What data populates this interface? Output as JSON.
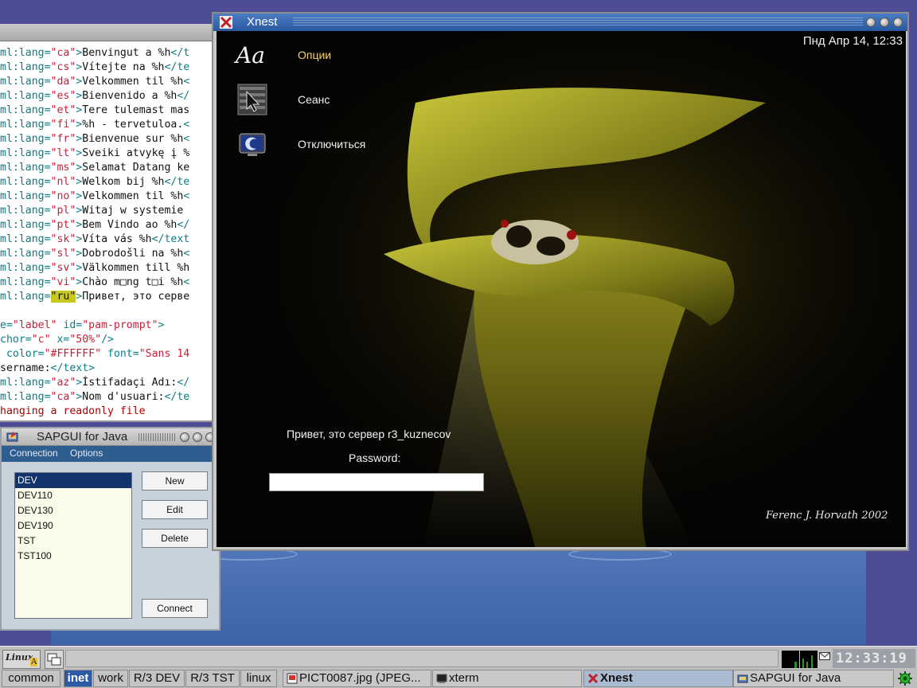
{
  "xterm": {
    "lines": [
      {
        "a": "ml:lang=",
        "s": "\"ca\"",
        "b": ">",
        "t": "Benvingut a %h",
        "c": "</t"
      },
      {
        "a": "ml:lang=",
        "s": "\"cs\"",
        "b": ">",
        "t": "Vítejte na %h",
        "c": "</te"
      },
      {
        "a": "ml:lang=",
        "s": "\"da\"",
        "b": ">",
        "t": "Velkommen til %h",
        "c": "<"
      },
      {
        "a": "ml:lang=",
        "s": "\"es\"",
        "b": ">",
        "t": "Bienvenido a %h",
        "c": "</"
      },
      {
        "a": "ml:lang=",
        "s": "\"et\"",
        "b": ">",
        "t": "Tere tulemast mas",
        "c": ""
      },
      {
        "a": "ml:lang=",
        "s": "\"fi\"",
        "b": ">",
        "t": "%h - tervetuloa.",
        "c": "<"
      },
      {
        "a": "ml:lang=",
        "s": "\"fr\"",
        "b": ">",
        "t": "Bienvenue sur %h",
        "c": "<"
      },
      {
        "a": "ml:lang=",
        "s": "\"lt\"",
        "b": ">",
        "t": "Sveiki atvykę į %",
        "c": ""
      },
      {
        "a": "ml:lang=",
        "s": "\"ms\"",
        "b": ">",
        "t": "Selamat Datang ke",
        "c": ""
      },
      {
        "a": "ml:lang=",
        "s": "\"nl\"",
        "b": ">",
        "t": "Welkom bij %h",
        "c": "</te"
      },
      {
        "a": "ml:lang=",
        "s": "\"no\"",
        "b": ">",
        "t": "Velkommen til %h",
        "c": "<"
      },
      {
        "a": "ml:lang=",
        "s": "\"pl\"",
        "b": ">",
        "t": "Witaj w systemie ",
        "c": ""
      },
      {
        "a": "ml:lang=",
        "s": "\"pt\"",
        "b": ">",
        "t": "Bem Vindo ao %h",
        "c": "</"
      },
      {
        "a": "ml:lang=",
        "s": "\"sk\"",
        "b": ">",
        "t": "Víta vás %h",
        "c": "</text"
      },
      {
        "a": "ml:lang=",
        "s": "\"sl\"",
        "b": ">",
        "t": "Dobrodošli na %h",
        "c": "<"
      },
      {
        "a": "ml:lang=",
        "s": "\"sv\"",
        "b": ">",
        "t": "Välkommen till %h",
        "c": ""
      },
      {
        "a": "ml:lang=",
        "s": "\"vi\"",
        "b": ">",
        "t": "Chào m□ng t□i %h",
        "c": "<"
      },
      {
        "a": "ml:lang=",
        "s": "\"ru\"",
        "b": ">",
        "t": "Привет, это серве",
        "c": "",
        "hl": true
      }
    ],
    "lines2": [
      {
        "a": "e=",
        "s": "\"label\"",
        "a2": " id=",
        "s2": "\"pam-prompt\"",
        "b": ">"
      },
      {
        "a": "chor=",
        "s": "\"c\"",
        "a2": " x=",
        "s2": "\"50%\"",
        "b": "/>"
      },
      {
        "a": " color=",
        "s": "\"#FFFFFF\"",
        "a2": " font=",
        "s2": "\"Sans 14",
        "b": ""
      }
    ],
    "line_username": {
      "t": "sername:",
      "c": "</text>"
    },
    "line_az": {
      "a": "ml:lang=",
      "s": "\"az\"",
      "b": ">",
      "t": "İstifadaçi Adı:",
      "c": "</"
    },
    "line_ca2": {
      "a": "ml:lang=",
      "s": "\"ca\"",
      "b": ">",
      "t": "Nom d'usuari:",
      "c": "</te"
    },
    "error": "hanging a readonly file"
  },
  "sap": {
    "title": "SAPGUI for Java",
    "menu": {
      "connection": "Connection",
      "options": "Options"
    },
    "systems": [
      "DEV",
      "DEV110",
      "DEV130",
      "DEV190",
      "TST",
      "TST100"
    ],
    "selected_index": 0,
    "buttons": {
      "new": "New",
      "edit": "Edit",
      "delete": "Delete",
      "connect": "Connect"
    }
  },
  "xnest": {
    "title": "Xnest",
    "datetime": "Пнд Апр 14, 12:33",
    "menu": {
      "options_glyph": "Aa",
      "options": "Опции",
      "session": "Сеанс",
      "disconnect": "Отключиться"
    },
    "greeting": "Привет, это сервер r3_kuznecov",
    "password_label": "Password:",
    "password_value": "",
    "signature": "Ferenc J. Horvath 2002",
    "colors": {
      "options_label": "#f3d36a",
      "label": "#f0f0f0"
    }
  },
  "taskbar": {
    "logo_line1": "Linux",
    "logo_line2": "A",
    "clock": "12:33:19",
    "workspaces": [
      {
        "label": "common",
        "active": false
      },
      {
        "label": "inet",
        "active": true
      },
      {
        "label": "work",
        "active": false
      },
      {
        "label": "R/3 DEV",
        "active": false
      },
      {
        "label": "R/3 TST",
        "active": false
      },
      {
        "label": "linux",
        "active": false
      }
    ],
    "tasks": [
      {
        "label": "PICT0087.jpg (JPEG...",
        "icon": "image-viewer-icon",
        "active": false
      },
      {
        "label": "xterm",
        "icon": "terminal-icon",
        "active": false
      },
      {
        "label": "Xnest",
        "icon": "x-icon",
        "active": true
      },
      {
        "label": "SAPGUI for Java",
        "icon": "sapgui-icon",
        "active": false
      }
    ],
    "colors": {
      "active_workspace": "#2e5aa3",
      "clock_bg": "#9aa0a6"
    }
  }
}
